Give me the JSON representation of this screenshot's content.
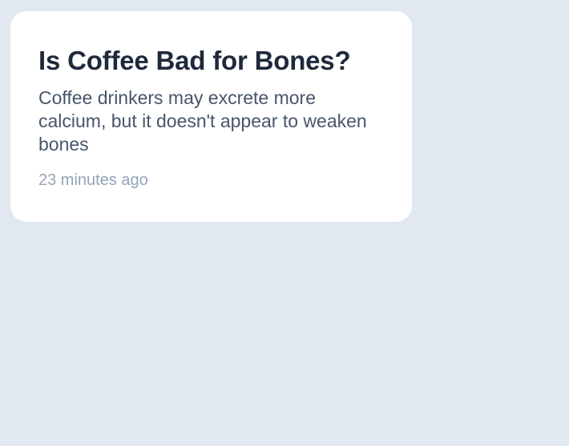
{
  "article_card": {
    "title": "Is Coffee Bad for Bones?",
    "summary": "Coffee drinkers may excrete more calcium, but it doesn't appear to weaken bones",
    "timestamp": "23 minutes ago"
  },
  "colors": {
    "background": "#e2e8f0",
    "card": "#ffffff",
    "title": "#1e293b",
    "summary": "#475569",
    "timestamp": "#94a3b8"
  }
}
